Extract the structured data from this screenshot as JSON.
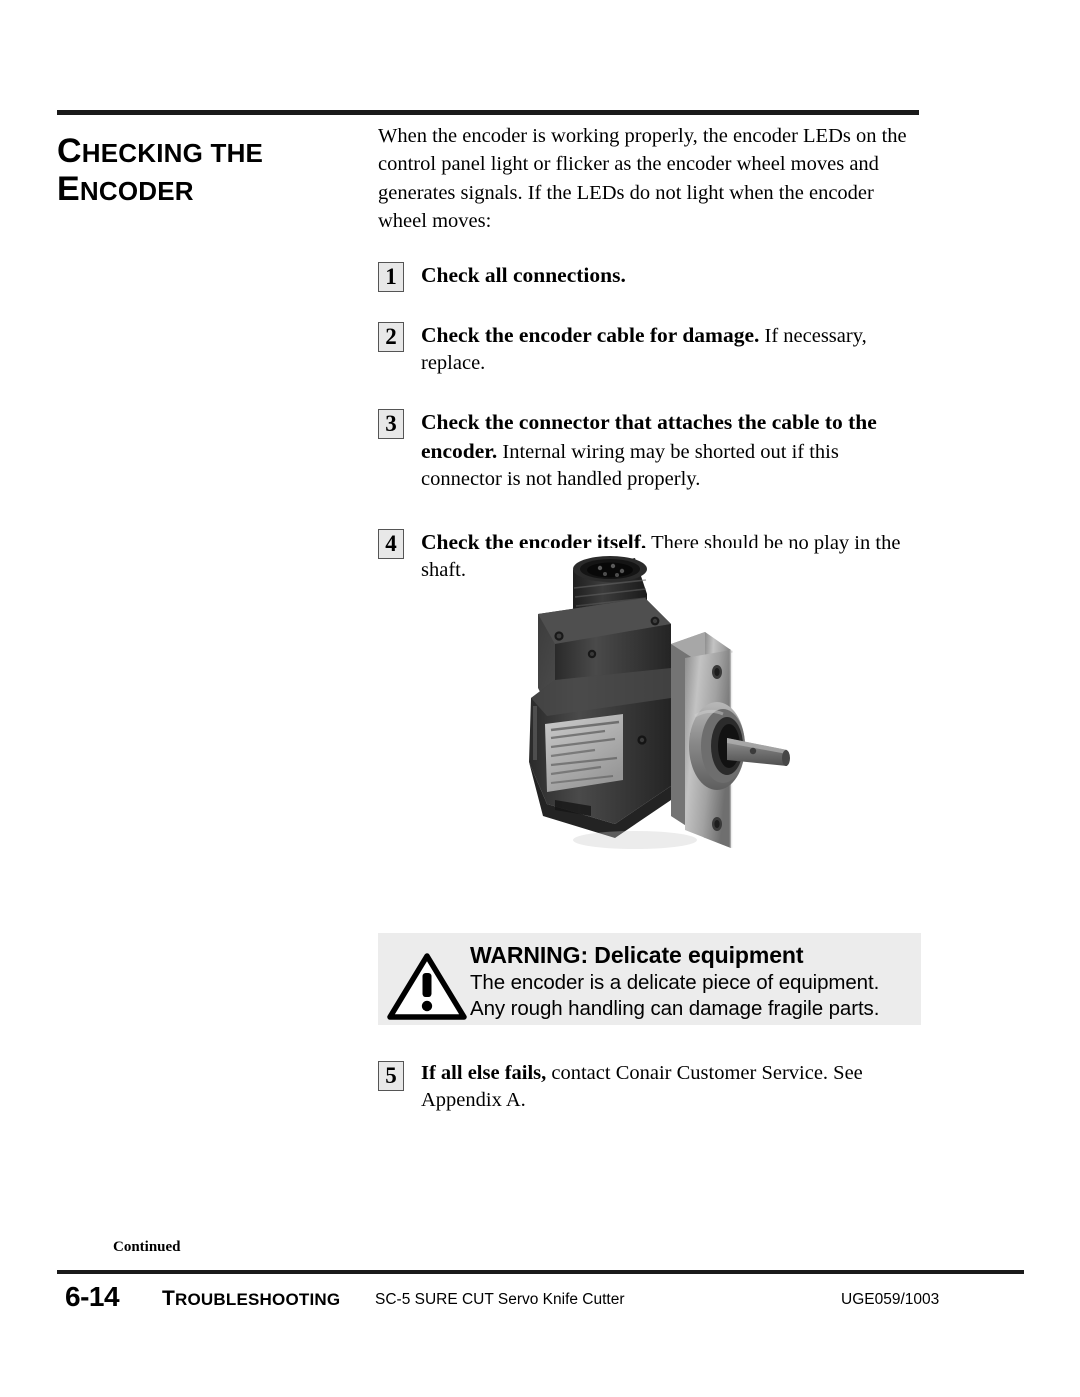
{
  "heading": {
    "line1_first": "C",
    "line1_rest": "HECKING THE",
    "line2_first": "E",
    "line2_rest": "NCODER"
  },
  "intro": "When the encoder is working properly, the encoder LEDs on the control panel light or flicker as the encoder wheel moves and generates signals. If the LEDs do not light when the encoder wheel moves:",
  "steps": [
    {
      "num": "1",
      "bold": "Check all connections.",
      "rest": ""
    },
    {
      "num": "2",
      "bold": "Check the encoder cable for damage.",
      "rest": " If necessary, replace."
    },
    {
      "num": "3",
      "bold": "Check the connector that attaches the cable to the encoder.",
      "rest": " Internal wiring may be shorted out if this connector is not handled properly."
    },
    {
      "num": "4",
      "bold": "Check the encoder itself.",
      "rest": " There should be no play in the shaft."
    }
  ],
  "figure": {
    "caption": "rotary encoder with connector, mounting flange and shaft"
  },
  "warning": {
    "title": "WARNING: Delicate equipment",
    "line1": "The encoder is a delicate piece of equipment.",
    "line2": "Any rough handling can damage fragile parts.",
    "background": "#ececec"
  },
  "step5": {
    "num": "5",
    "bold": "If all else fails,",
    "rest": " contact Conair Customer Service. See Appendix A."
  },
  "footer": {
    "continued": "Continued",
    "page_number": "6-14",
    "section_first": "T",
    "section_rest": "ROUBLESHOOTING",
    "model": "SC-5 SURE CUT Servo Knife Cutter",
    "doc_code": "UGE059/1003"
  }
}
